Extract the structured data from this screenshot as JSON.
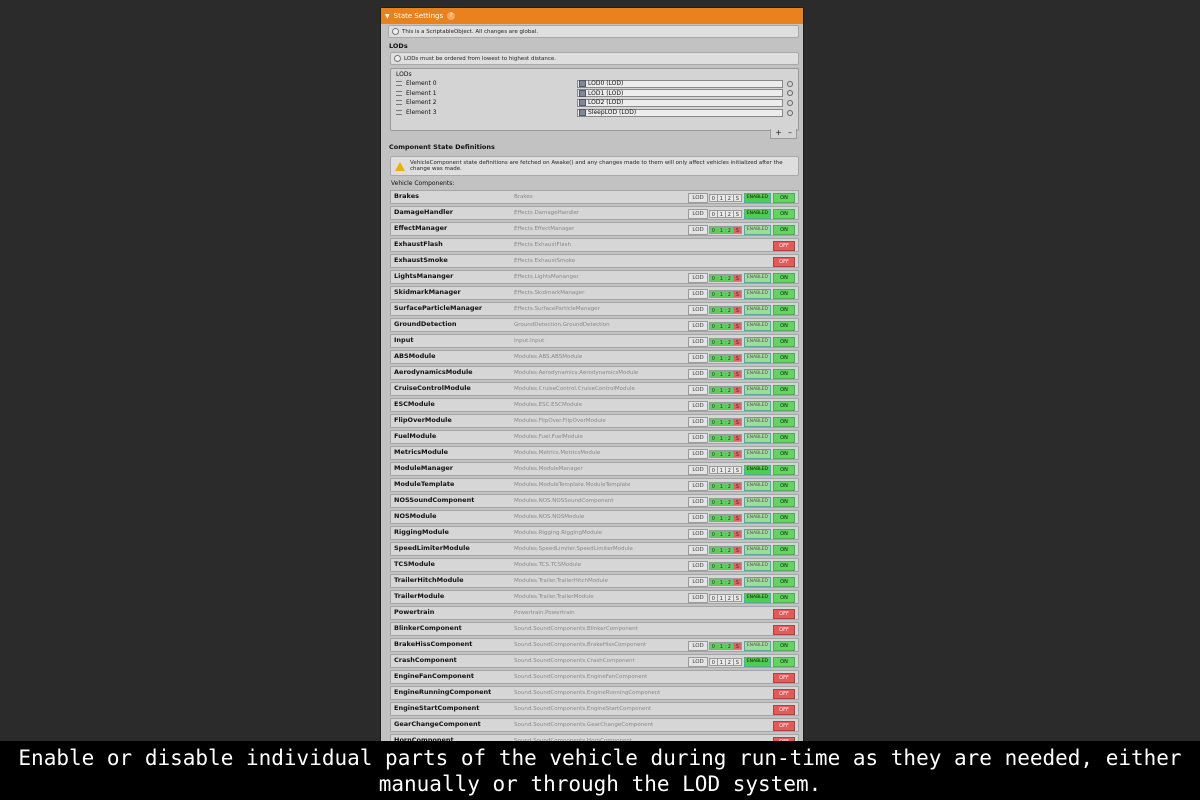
{
  "header": {
    "title": "State Settings",
    "help_icon": "help-icon"
  },
  "notice": "This is a ScriptableObject. All changes are global.",
  "lods": {
    "section_title": "LODs",
    "notice": "LODs must be ordered from lowest to highest distance.",
    "list_title": "LODs",
    "elements": [
      {
        "label": "Element 0",
        "value": "LOD0 (LOD)"
      },
      {
        "label": "Element 1",
        "value": "LOD1 (LOD)"
      },
      {
        "label": "Element 2",
        "value": "LOD2 (LOD)"
      },
      {
        "label": "Element 3",
        "value": "SleepLOD (LOD)"
      }
    ],
    "add_label": "+",
    "remove_label": "–"
  },
  "components_section": {
    "title": "Component State Definitions",
    "warning": "VehicleComponent state definitions are fetched on Awake() and any changes made to them will only affect vehicles initialized after the change was made.",
    "list_label": "Vehicle Components:"
  },
  "lod_tag": "LOD",
  "enabled_label": "ENABLED",
  "on_label": "ON",
  "off_label": "OFF",
  "components": [
    {
      "name": "Brakes",
      "path": "Brakes",
      "lod": true,
      "levels": [
        "n",
        "n",
        "n",
        "n"
      ],
      "enabled": true,
      "state": "on"
    },
    {
      "name": "DamageHandler",
      "path": "Effects.DamageHandler",
      "lod": true,
      "levels": [
        "n",
        "n",
        "n",
        "n"
      ],
      "enabled": true,
      "state": "on"
    },
    {
      "name": "EffectManager",
      "path": "Effects.EffectManager",
      "lod": true,
      "levels": [
        "g",
        "g",
        "g",
        "r"
      ],
      "enabled": false,
      "state": "on"
    },
    {
      "name": "ExhaustFlash",
      "path": "Effects.ExhaustFlash",
      "lod": false,
      "state": "off"
    },
    {
      "name": "ExhaustSmoke",
      "path": "Effects.ExhaustSmoke",
      "lod": false,
      "state": "off"
    },
    {
      "name": "LightsMananger",
      "path": "Effects.LightsMananger",
      "lod": true,
      "levels": [
        "g",
        "g",
        "g",
        "r"
      ],
      "enabled": false,
      "state": "on"
    },
    {
      "name": "SkidmarkManager",
      "path": "Effects.SkidmarkManager",
      "lod": true,
      "levels": [
        "g",
        "g",
        "g",
        "r"
      ],
      "enabled": false,
      "state": "on"
    },
    {
      "name": "SurfaceParticleManager",
      "path": "Effects.SurfaceParticleManager",
      "lod": true,
      "levels": [
        "g",
        "g",
        "g",
        "r"
      ],
      "enabled": false,
      "state": "on"
    },
    {
      "name": "GroundDetection",
      "path": "GroundDetection.GroundDetection",
      "lod": true,
      "levels": [
        "g",
        "g",
        "g",
        "r"
      ],
      "enabled": false,
      "state": "on"
    },
    {
      "name": "Input",
      "path": "Input.Input",
      "lod": true,
      "levels": [
        "g",
        "g",
        "g",
        "r"
      ],
      "enabled": false,
      "state": "on"
    },
    {
      "name": "ABSModule",
      "path": "Modules.ABS.ABSModule",
      "lod": true,
      "levels": [
        "g",
        "g",
        "g",
        "r"
      ],
      "enabled": false,
      "state": "on"
    },
    {
      "name": "AerodynamicsModule",
      "path": "Modules.Aerodynamics.AerodynamicsModule",
      "lod": true,
      "levels": [
        "g",
        "g",
        "g",
        "r"
      ],
      "enabled": false,
      "state": "on"
    },
    {
      "name": "CruiseControlModule",
      "path": "Modules.CruiseControl.CruiseControlModule",
      "lod": true,
      "levels": [
        "g",
        "g",
        "g",
        "r"
      ],
      "enabled": false,
      "state": "on"
    },
    {
      "name": "ESCModule",
      "path": "Modules.ESC.ESCModule",
      "lod": true,
      "levels": [
        "g",
        "g",
        "g",
        "r"
      ],
      "enabled": false,
      "state": "on"
    },
    {
      "name": "FlipOverModule",
      "path": "Modules.FlipOver.FlipOverModule",
      "lod": true,
      "levels": [
        "g",
        "g",
        "g",
        "r"
      ],
      "enabled": false,
      "state": "on"
    },
    {
      "name": "FuelModule",
      "path": "Modules.Fuel.FuelModule",
      "lod": true,
      "levels": [
        "g",
        "g",
        "g",
        "r"
      ],
      "enabled": false,
      "state": "on"
    },
    {
      "name": "MetricsModule",
      "path": "Modules.Metrics.MetricsModule",
      "lod": true,
      "levels": [
        "g",
        "g",
        "g",
        "r"
      ],
      "enabled": false,
      "state": "on"
    },
    {
      "name": "ModuleManager",
      "path": "Modules.ModuleManager",
      "lod": true,
      "levels": [
        "n",
        "n",
        "n",
        "n"
      ],
      "enabled": true,
      "state": "on"
    },
    {
      "name": "ModuleTemplate",
      "path": "Modules.ModuleTemplate.ModuleTemplate",
      "lod": true,
      "levels": [
        "g",
        "g",
        "g",
        "r"
      ],
      "enabled": false,
      "state": "on"
    },
    {
      "name": "NOSSoundComponent",
      "path": "Modules.NOS.NOSSoundComponent",
      "lod": true,
      "levels": [
        "g",
        "g",
        "g",
        "r"
      ],
      "enabled": false,
      "state": "on"
    },
    {
      "name": "NOSModule",
      "path": "Modules.NOS.NOSModule",
      "lod": true,
      "levels": [
        "g",
        "g",
        "g",
        "r"
      ],
      "enabled": false,
      "state": "on"
    },
    {
      "name": "RiggingModule",
      "path": "Modules.Rigging.RiggingModule",
      "lod": true,
      "levels": [
        "g",
        "g",
        "g",
        "r"
      ],
      "enabled": false,
      "state": "on"
    },
    {
      "name": "SpeedLimiterModule",
      "path": "Modules.SpeedLimiter.SpeedLimiterModule",
      "lod": true,
      "levels": [
        "g",
        "g",
        "g",
        "r"
      ],
      "enabled": false,
      "state": "on"
    },
    {
      "name": "TCSModule",
      "path": "Modules.TCS.TCSModule",
      "lod": true,
      "levels": [
        "g",
        "g",
        "g",
        "r"
      ],
      "enabled": false,
      "state": "on"
    },
    {
      "name": "TrailerHitchModule",
      "path": "Modules.Trailer.TrailerHitchModule",
      "lod": true,
      "levels": [
        "g",
        "g",
        "g",
        "r"
      ],
      "enabled": false,
      "state": "on"
    },
    {
      "name": "TrailerModule",
      "path": "Modules.Trailer.TrailerModule",
      "lod": true,
      "levels": [
        "n",
        "n",
        "n",
        "n"
      ],
      "enabled": true,
      "state": "on"
    },
    {
      "name": "Powertrain",
      "path": "Powertrain.Powertrain",
      "lod": false,
      "state": "off"
    },
    {
      "name": "BlinkerComponent",
      "path": "Sound.SoundComponents.BlinkerComponent",
      "lod": false,
      "state": "off"
    },
    {
      "name": "BrakeHissComponent",
      "path": "Sound.SoundComponents.BrakeHissComponent",
      "lod": true,
      "levels": [
        "g",
        "g",
        "g",
        "r"
      ],
      "enabled": false,
      "state": "on"
    },
    {
      "name": "CrashComponent",
      "path": "Sound.SoundComponents.CrashComponent",
      "lod": true,
      "levels": [
        "n",
        "n",
        "n",
        "n"
      ],
      "enabled": true,
      "state": "on"
    },
    {
      "name": "EngineFanComponent",
      "path": "Sound.SoundComponents.EngineFanComponent",
      "lod": false,
      "state": "off"
    },
    {
      "name": "EngineRunningComponent",
      "path": "Sound.SoundComponents.EngineRunningComponent",
      "lod": false,
      "state": "off"
    },
    {
      "name": "EngineStartComponent",
      "path": "Sound.SoundComponents.EngineStartComponent",
      "lod": false,
      "state": "off"
    },
    {
      "name": "GearChangeComponent",
      "path": "Sound.SoundComponents.GearChangeComponent",
      "lod": false,
      "state": "off"
    },
    {
      "name": "HornComponent",
      "path": "Sound.SoundComponents.HornComponent",
      "lod": false,
      "state": "off"
    }
  ],
  "level_labels": [
    "0",
    "1",
    "2",
    "S"
  ],
  "caption": "Enable or disable individual parts of the vehicle during run-time as they are needed, either manually or through the LOD system."
}
